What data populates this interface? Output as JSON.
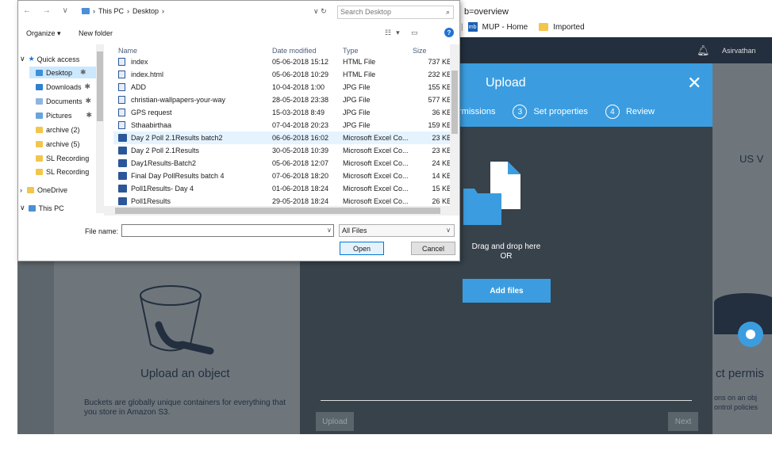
{
  "browser": {
    "url_fragment": "b=overview",
    "bookmarks": [
      {
        "label": "MUP - Home",
        "icon": "mup-icon"
      },
      {
        "label": "Imported",
        "icon": "folder-icon"
      }
    ],
    "user": "Asirvathan"
  },
  "upload_modal": {
    "title": "Upload",
    "close": "✕",
    "steps": [
      {
        "num": "",
        "label": "rmissions"
      },
      {
        "num": "3",
        "label": "Set properties"
      },
      {
        "num": "4",
        "label": "Review"
      }
    ],
    "drop_text_1": "Drag and drop here",
    "drop_text_2": "OR",
    "add_files_label": "Add files",
    "upload_button": "Upload",
    "next_button": "Next"
  },
  "background": {
    "left_card_title": "Upload an object",
    "left_card_desc": "Buckets are globally unique containers for everything that you store in Amazon S3.",
    "right_top_text": "US V",
    "right_card_title": "ct permis",
    "right_card_desc": "ons on an obj ontrol policies"
  },
  "file_dialog": {
    "breadcrumb": [
      "This PC",
      "Desktop"
    ],
    "search_placeholder": "Search Desktop",
    "organize": "Organize ▾",
    "new_folder": "New folder",
    "nav_items": [
      {
        "label": "Quick access",
        "indent": 0,
        "pinned": false,
        "icon": "star-icon"
      },
      {
        "label": "Desktop",
        "indent": 1,
        "pinned": true,
        "selected": true,
        "icon": "desktop-icon"
      },
      {
        "label": "Downloads",
        "indent": 1,
        "pinned": true,
        "icon": "downloads-icon"
      },
      {
        "label": "Documents",
        "indent": 1,
        "pinned": true,
        "icon": "documents-icon"
      },
      {
        "label": "Pictures",
        "indent": 1,
        "pinned": true,
        "icon": "pictures-icon"
      },
      {
        "label": "archive (2)",
        "indent": 1,
        "pinned": false,
        "icon": "folder-icon"
      },
      {
        "label": "archive (5)",
        "indent": 1,
        "pinned": false,
        "icon": "folder-icon"
      },
      {
        "label": "SL Recording",
        "indent": 1,
        "pinned": false,
        "icon": "folder-icon"
      },
      {
        "label": "SL Recording",
        "indent": 1,
        "pinned": false,
        "icon": "folder-icon"
      },
      {
        "label": "OneDrive",
        "indent": 0,
        "pinned": false,
        "icon": "folder-icon"
      },
      {
        "label": "This PC",
        "indent": 0,
        "pinned": false,
        "icon": "pc-icon"
      }
    ],
    "columns": [
      "Name",
      "Date modified",
      "Type",
      "Size"
    ],
    "files": [
      {
        "name": "index",
        "date": "05-06-2018 15:12",
        "type": "HTML File",
        "size": "737 KB",
        "kind": "html"
      },
      {
        "name": "index.html",
        "date": "05-06-2018 10:29",
        "type": "HTML File",
        "size": "232 KB",
        "kind": "html"
      },
      {
        "name": "ADD",
        "date": "10-04-2018 1:00",
        "type": "JPG File",
        "size": "155 KB",
        "kind": "jpg"
      },
      {
        "name": "christian-wallpapers-your-way",
        "date": "28-05-2018 23:38",
        "type": "JPG File",
        "size": "577 KB",
        "kind": "jpg"
      },
      {
        "name": "GPS request",
        "date": "15-03-2018 8:49",
        "type": "JPG File",
        "size": "36 KB",
        "kind": "jpg"
      },
      {
        "name": "Sthaabirthaa",
        "date": "07-04-2018 20:23",
        "type": "JPG File",
        "size": "159 KB",
        "kind": "jpg"
      },
      {
        "name": "Day 2 Poll 2.1Results batch2",
        "date": "06-06-2018 16:02",
        "type": "Microsoft Excel Co...",
        "size": "23 KB",
        "kind": "xls",
        "hover": true
      },
      {
        "name": "Day 2 Poll 2.1Results",
        "date": "30-05-2018 10:39",
        "type": "Microsoft Excel Co...",
        "size": "23 KB",
        "kind": "xls"
      },
      {
        "name": "Day1Results-Batch2",
        "date": "05-06-2018 12:07",
        "type": "Microsoft Excel Co...",
        "size": "24 KB",
        "kind": "xls"
      },
      {
        "name": "Final Day PollResults batch 4",
        "date": "07-06-2018 18:20",
        "type": "Microsoft Excel Co...",
        "size": "14 KB",
        "kind": "xls"
      },
      {
        "name": "Poll1Results- Day 4",
        "date": "01-06-2018 18:24",
        "type": "Microsoft Excel Co...",
        "size": "15 KB",
        "kind": "xls"
      },
      {
        "name": "Poll1Results",
        "date": "29-05-2018 18:24",
        "type": "Microsoft Excel Co...",
        "size": "26 KB",
        "kind": "xls"
      }
    ],
    "file_name_label": "File name:",
    "file_name_value": "",
    "filter": "All Files",
    "open_button": "Open",
    "cancel_button": "Cancel"
  }
}
